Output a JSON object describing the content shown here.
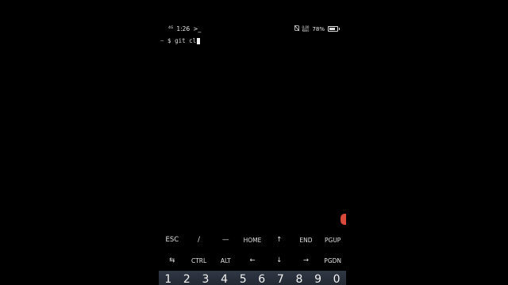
{
  "status_bar": {
    "signal": "4G",
    "time": "1:26",
    "app_indicator": ">_",
    "net_speed_value": "0.00",
    "net_speed_unit": "KB/s",
    "battery_percent": "78%",
    "battery_level": 0.78,
    "icons": [
      "signal-icon",
      "terminal-icon",
      "nfc-icon",
      "battery-icon"
    ]
  },
  "terminal": {
    "prompt_dir": "~",
    "prompt_symbol": "$",
    "command": "git cl"
  },
  "extra_keys": {
    "row1": [
      "ESC",
      "/",
      "—",
      "HOME",
      "↑",
      "END",
      "PGUP"
    ],
    "row2": [
      "⇆",
      "CTRL",
      "ALT",
      "←",
      "↓",
      "→",
      "PGDN"
    ]
  },
  "number_row": [
    "1",
    "2",
    "3",
    "4",
    "5",
    "6",
    "7",
    "8",
    "9",
    "0"
  ],
  "colors": {
    "background": "#000000",
    "text": "#e0e0e0",
    "keyboard": "#2b323c",
    "accent_dot": "#d94a3a"
  }
}
